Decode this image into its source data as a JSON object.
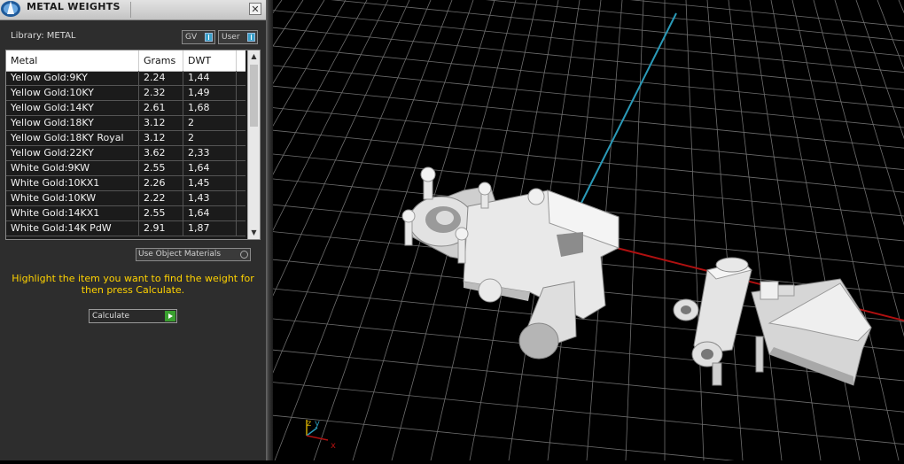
{
  "panel": {
    "title": "METAL WEIGHTS",
    "close_label": "✕",
    "library_label": "Library: METAL",
    "toggles": {
      "gv": "GV",
      "user": "User"
    },
    "table": {
      "headers": {
        "metal": "Metal",
        "grams": "Grams",
        "dwt": "DWT"
      },
      "rows": [
        {
          "metal": "Yellow Gold:9KY",
          "grams": "2.24",
          "dwt": "1,44"
        },
        {
          "metal": "Yellow Gold:10KY",
          "grams": "2.32",
          "dwt": "1,49"
        },
        {
          "metal": "Yellow Gold:14KY",
          "grams": "2.61",
          "dwt": "1,68"
        },
        {
          "metal": "Yellow Gold:18KY",
          "grams": "3.12",
          "dwt": "2"
        },
        {
          "metal": "Yellow Gold:18KY Royal",
          "grams": "3.12",
          "dwt": "2"
        },
        {
          "metal": "Yellow Gold:22KY",
          "grams": "3.62",
          "dwt": "2,33"
        },
        {
          "metal": "White Gold:9KW",
          "grams": "2.55",
          "dwt": "1,64"
        },
        {
          "metal": "White Gold:10KX1",
          "grams": "2.26",
          "dwt": "1,45"
        },
        {
          "metal": "White Gold:10KW",
          "grams": "2.22",
          "dwt": "1,43"
        },
        {
          "metal": "White Gold:14KX1",
          "grams": "2.55",
          "dwt": "1,64"
        },
        {
          "metal": "White Gold:14K PdW",
          "grams": "2.91",
          "dwt": "1,87"
        }
      ]
    },
    "use_object_materials_label": "Use Object Materials",
    "instruction": "Highlight the item you want to find the weight for then press Calculate.",
    "calculate_label": "Calculate"
  },
  "viewport": {
    "axis_indicator": {
      "z": "z",
      "y": "y",
      "x": "x"
    }
  },
  "colors": {
    "panel_bg": "#2d2d2d",
    "instruction_text": "#ffd200",
    "grid_line": "#6e6e6e",
    "x_axis": "#b01010",
    "y_axis": "#2a9ab8"
  },
  "icons": {
    "logo": "app-logo-icon",
    "close": "close-icon",
    "scroll_up": "chevron-up-icon",
    "scroll_down": "chevron-down-icon",
    "calculate": "play-arrow-icon"
  }
}
